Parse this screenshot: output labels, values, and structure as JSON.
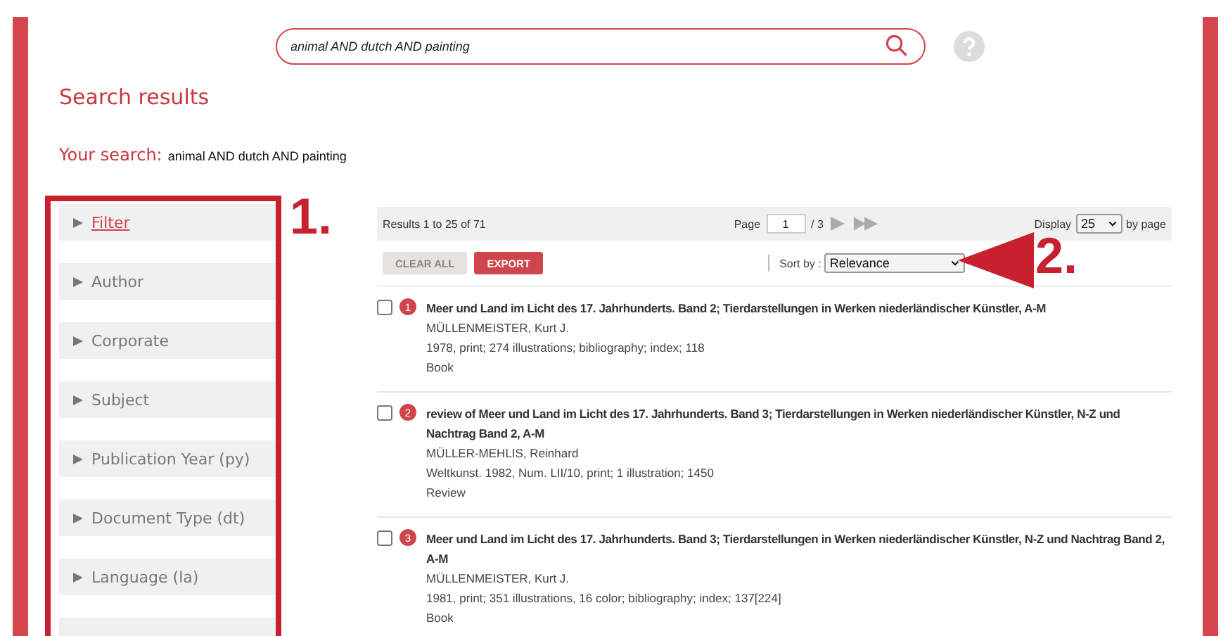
{
  "search": {
    "value": "animal AND dutch AND painting"
  },
  "heading": "Search results",
  "your_search": {
    "label": "Your search:",
    "value": "animal AND dutch AND painting"
  },
  "facets": [
    {
      "label": "Filter",
      "selected": true
    },
    {
      "label": "Author",
      "selected": false
    },
    {
      "label": "Corporate",
      "selected": false
    },
    {
      "label": "Subject",
      "selected": false
    },
    {
      "label": "Publication Year (py)",
      "selected": false
    },
    {
      "label": "Document Type (dt)",
      "selected": false
    },
    {
      "label": "Language (la)",
      "selected": false
    }
  ],
  "toolbar": {
    "results": "Results 1 to 25 of 71",
    "page_label": "Page",
    "page": "1",
    "page_total": "/ 3",
    "display_label": "Display",
    "display": "25",
    "by_page": "by page"
  },
  "buttons": [
    {
      "label": "CLEAR ALL",
      "kind": "secondary"
    },
    {
      "label": "EXPORT",
      "kind": "primary"
    }
  ],
  "sort": {
    "label": "Sort by :",
    "value": "Relevance"
  },
  "results": [
    {
      "number": "1",
      "checked": false,
      "title": "Meer und Land im Licht des 17. Jahrhunderts. Band 2; Tierdarstellungen in Werken niederländischer Künstler, A-M",
      "author": "MÜLLENMEISTER, Kurt J.",
      "details": "1978, print; 274 illustrations; bibliography; index; 118",
      "type": "Book"
    },
    {
      "number": "2",
      "checked": false,
      "title": "review of Meer und Land im Licht des 17. Jahrhunderts. Band 3; Tierdarstellungen in Werken niederländischer Künstler, N-Z und Nachtrag Band 2, A-M",
      "author": "MÜLLER-MEHLIS, Reinhard",
      "details": "Weltkunst. 1982, Num. LII/10, print; 1 illustration; 1450",
      "type": "Review"
    },
    {
      "number": "3",
      "checked": false,
      "title": "Meer und Land im Licht des 17. Jahrhunderts. Band 3; Tierdarstellungen in Werken niederländischer Künstler, N-Z und Nachtrag Band 2, A-M",
      "author": "MÜLLENMEISTER, Kurt J.",
      "details": "1981, print; 351 illustrations, 16 color; bibliography; index; 137[224]",
      "type": "Book"
    }
  ],
  "annotations": [
    "1.",
    "2."
  ]
}
